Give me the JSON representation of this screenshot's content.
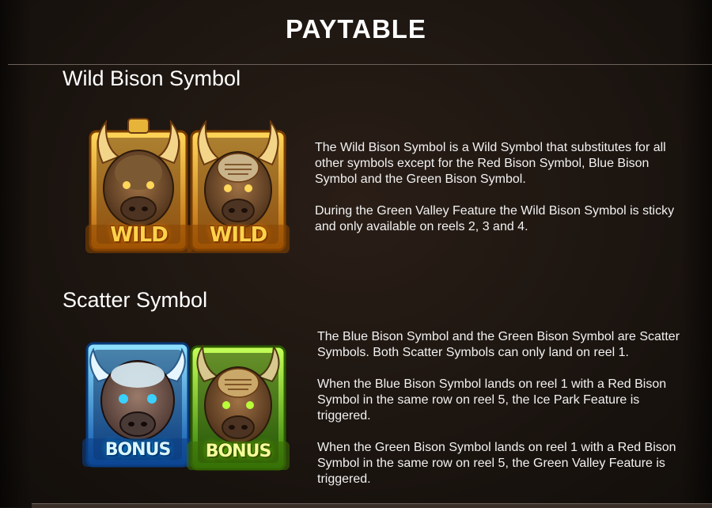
{
  "header": {
    "title": "PAYTABLE"
  },
  "sections": [
    {
      "heading": "Wild Bison Symbol",
      "symbols": [
        {
          "icon": "wild-bison-gold-icon",
          "label": "WILD"
        },
        {
          "icon": "wild-bison-gold-alt-icon",
          "label": "WILD"
        }
      ],
      "paragraphs": [
        "The Wild Bison Symbol is a Wild Symbol that substitutes for all other symbols except for the Red Bison Symbol, Blue Bison Symbol and the Green Bison Symbol.",
        "During the Green Valley Feature the Wild Bison Symbol is sticky and only available on reels 2, 3 and 4."
      ]
    },
    {
      "heading": "Scatter Symbol",
      "symbols": [
        {
          "icon": "blue-bison-bonus-icon",
          "label": "BONUS"
        },
        {
          "icon": "green-bison-bonus-icon",
          "label": "BONUS"
        }
      ],
      "paragraphs": [
        "The Blue Bison Symbol and the Green Bison Symbol are Scatter Symbols. Both Scatter Symbols can only land on reel 1.",
        "When the Blue Bison Symbol lands on reel 1 with a Red Bison Symbol in the same row on reel 5, the Ice Park Feature is triggered.",
        "When the Green Bison Symbol lands on reel 1 with a Red Bison Symbol in the same row on reel 5, the Green Valley Feature is triggered."
      ]
    }
  ],
  "colors": {
    "gold": "#e0a21a",
    "blue": "#2aa9ff",
    "green": "#7cd41c",
    "background": "#1c1510"
  }
}
